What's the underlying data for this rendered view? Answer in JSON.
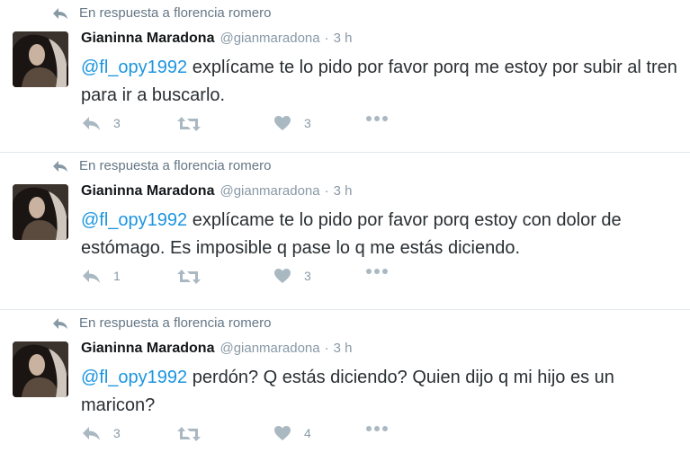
{
  "tweets": [
    {
      "reply_context": "En respuesta a florencia romero",
      "name": "Gianinna Maradona",
      "handle": "@gianmaradona",
      "separator": "·",
      "time": "3 h",
      "mention": "@fl_opy1992",
      "text": " explícame te lo pido por favor porq me estoy por subir al tren para ir a buscarlo.",
      "replies": "3",
      "likes": "3"
    },
    {
      "reply_context": "En respuesta a florencia romero",
      "name": "Gianinna Maradona",
      "handle": "@gianmaradona",
      "separator": "·",
      "time": "3 h",
      "mention": "@fl_opy1992",
      "text": " explícame te lo pido por favor porq estoy con dolor de estómago. Es imposible q pase lo q me estás diciendo.",
      "replies": "1",
      "likes": "3"
    },
    {
      "reply_context": "En respuesta a florencia romero",
      "name": "Gianinna Maradona",
      "handle": "@gianmaradona",
      "separator": "·",
      "time": "3 h",
      "mention": "@fl_opy1992",
      "text": " perdón? Q estás diciendo? Quien dijo q mi hijo es un maricon?",
      "replies": "3",
      "likes": "4"
    }
  ],
  "icons": {
    "reply_context": "reply-arrow-icon",
    "reply": "reply-icon",
    "retweet": "retweet-icon",
    "like": "heart-icon",
    "more": "more-icon"
  },
  "colors": {
    "mention": "#1b95e0",
    "secondary_text": "#8899a6",
    "action_icon": "#aab8c2",
    "divider": "#e1e8ed"
  }
}
